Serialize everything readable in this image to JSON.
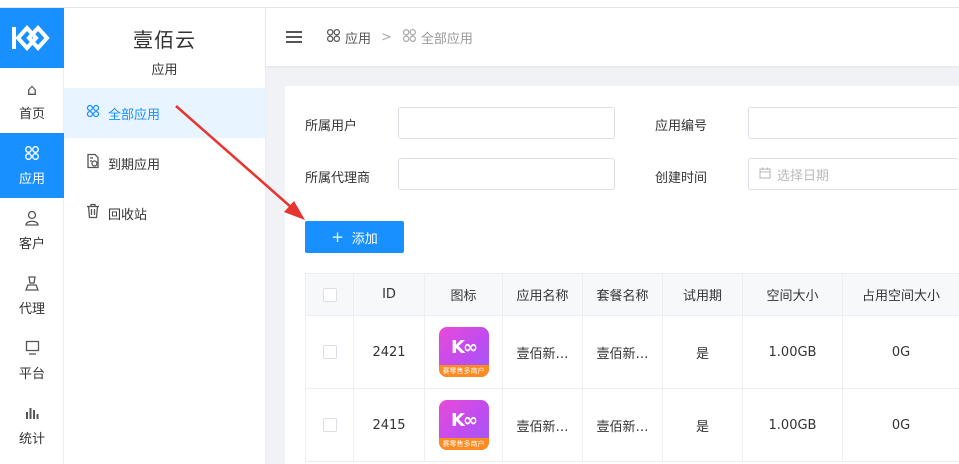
{
  "rail": {
    "items": [
      {
        "label": "首页",
        "icon": "home-icon",
        "glyph": "⌂"
      },
      {
        "label": "应用",
        "icon": "app-grid-icon",
        "glyph": "⁘"
      },
      {
        "label": "客户",
        "icon": "user-icon",
        "glyph": "♙"
      },
      {
        "label": "代理",
        "icon": "agent-icon",
        "glyph": "♙"
      },
      {
        "label": "平台",
        "icon": "monitor-icon",
        "glyph": "▭"
      },
      {
        "label": "统计",
        "icon": "bar-chart-icon",
        "glyph": "ıl"
      }
    ],
    "active_index": 1
  },
  "sidebar": {
    "title": "壹佰云",
    "subtitle": "应用",
    "items": [
      {
        "label": "全部应用",
        "icon": "app-grid-icon"
      },
      {
        "label": "到期应用",
        "icon": "expired-doc-icon"
      },
      {
        "label": "回收站",
        "icon": "trash-icon"
      }
    ]
  },
  "header": {
    "breadcrumb": [
      "应用",
      ">",
      "全部应用"
    ]
  },
  "filters": {
    "owner_label": "所属用户",
    "owner_value": "",
    "app_no_label": "应用编号",
    "app_no_value": "",
    "agent_label": "所属代理商",
    "agent_value": "",
    "created_label": "创建时间",
    "date_placeholder": "选择日期"
  },
  "add_button": {
    "label": "添加"
  },
  "table": {
    "headers": [
      "ID",
      "图标",
      "应用名称",
      "套餐名称",
      "试用期",
      "空间大小",
      "占用空间大小"
    ],
    "rows": [
      {
        "id": "2421",
        "name": "壹佰新…",
        "plan": "壹佰新…",
        "trial": "是",
        "space": "1.00GB",
        "used": "0G",
        "icon_band": "赛零售多商户"
      },
      {
        "id": "2415",
        "name": "壹佰新…",
        "plan": "壹佰新…",
        "trial": "是",
        "space": "1.00GB",
        "used": "0G",
        "icon_band": "赛零售多商户"
      }
    ]
  },
  "colors": {
    "accent": "#1890ff",
    "arrow": "#e8342e"
  }
}
